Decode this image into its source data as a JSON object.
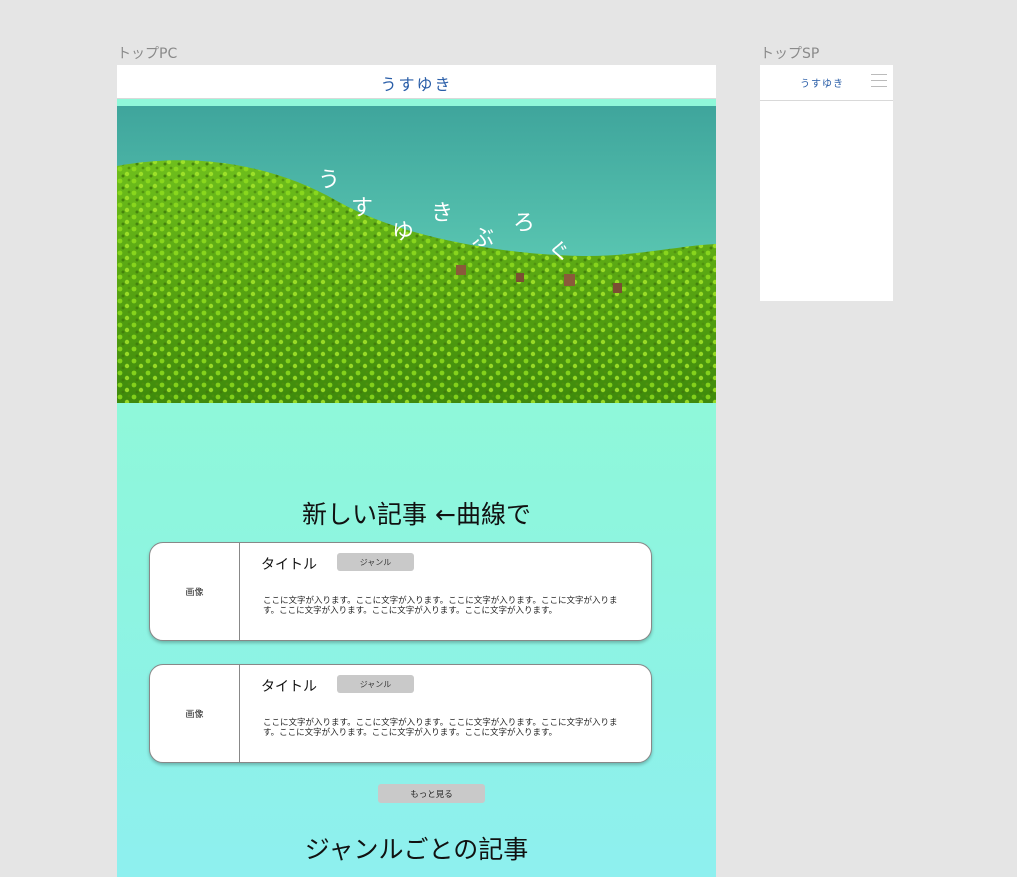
{
  "frames": {
    "pc_label": "トップPC",
    "sp_label": "トップSP"
  },
  "pc": {
    "logo": "うすゆき",
    "hero_chars": [
      "う",
      "す",
      "ゆ",
      "き",
      "ぶ",
      "ろ",
      "ぐ"
    ],
    "latest_heading": "新しい記事 ←曲線で",
    "articles": [
      {
        "image_label": "画像",
        "title": "タイトル",
        "genre": "ジャンル",
        "body": "ここに文字が入ります。ここに文字が入ります。ここに文字が入ります。ここに文字が入ります。ここに文字が入ります。ここに文字が入ります。ここに文字が入ります。"
      },
      {
        "image_label": "画像",
        "title": "タイトル",
        "genre": "ジャンル",
        "body": "ここに文字が入ります。ここに文字が入ります。ここに文字が入ります。ここに文字が入ります。ここに文字が入ります。ここに文字が入ります。ここに文字が入ります。"
      }
    ],
    "more_button": "もっと見る",
    "genre_heading": "ジャンルごとの記事"
  },
  "sp": {
    "logo": "うすゆき",
    "menu_icon": "hamburger-icon"
  },
  "colors": {
    "page_bg": "#e5e5e5",
    "mint": "#8ff8d9",
    "logo_blue": "#2a5ea8",
    "button_gray": "#c9c9c9"
  }
}
